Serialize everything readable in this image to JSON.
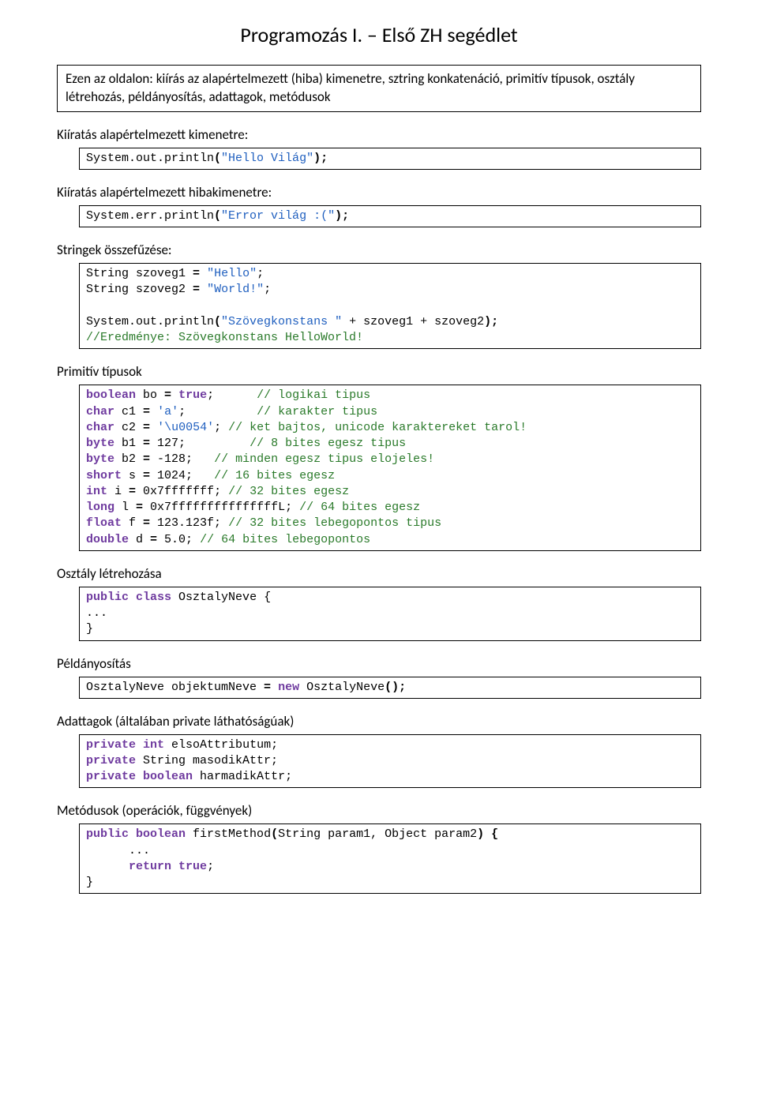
{
  "title": "Programozás I. – Első ZH segédlet",
  "intro": "Ezen az oldalon: kiírás az alapértelmezett (hiba) kimenetre, sztring konkatenáció, primitív típusok, osztály létrehozás, példányosítás, adattagok, metódusok",
  "sections": {
    "out_label": "Kiíratás alapértelmezett kimenetre:",
    "out_code": {
      "l1a": "System.out.println",
      "l1b": "(",
      "l1c": "\"Hello Világ\"",
      "l1d": ");"
    },
    "err_label": "Kiíratás alapértelmezett hibakimenetre:",
    "err_code": {
      "l1a": "System.err.println",
      "l1b": "(",
      "l1c": "\"Error világ :(\"",
      "l1d": ");"
    },
    "concat_label": "Stringek összefűzése:",
    "concat": {
      "l1a": "String szoveg1 ",
      "l1b": "=",
      "l1c": " ",
      "l1d": "\"Hello\"",
      "l1e": ";",
      "l2a": "String szoveg2 ",
      "l2b": "=",
      "l2c": " ",
      "l2d": "\"World!\"",
      "l2e": ";",
      "l3a": "System.out.println",
      "l3b": "(",
      "l3c": "\"Szövegkonstans \"",
      "l3d": " + szoveg1 + szoveg2",
      "l3e": ");",
      "l4": "//Eredménye: Szövegkonstans HelloWorld!"
    },
    "prim_label": "Primitív típusok",
    "prim": {
      "l1a": "boolean",
      "l1b": " bo ",
      "l1c": "=",
      "l1d": " ",
      "l1e": "true",
      "l1f": ";      ",
      "l1g": "// logikai tipus",
      "l2a": "char",
      "l2b": " c1 ",
      "l2c": "=",
      "l2d": " ",
      "l2e": "'a'",
      "l2f": ";          ",
      "l2g": "// karakter tipus",
      "l3a": "char",
      "l3b": " c2 ",
      "l3c": "=",
      "l3d": " ",
      "l3e": "'\\u0054'",
      "l3f": "; ",
      "l3g": "// ket bajtos, unicode karaktereket tarol!",
      "l4a": "byte",
      "l4b": " b1 ",
      "l4c": "=",
      "l4d": " 127;         ",
      "l4g": "// 8 bites egesz tipus",
      "l5a": "byte",
      "l5b": " b2 ",
      "l5c": "=",
      "l5d": " -128;   ",
      "l5g": "// minden egesz tipus elojeles!",
      "l6a": "short",
      "l6b": " s ",
      "l6c": "=",
      "l6d": " 1024;   ",
      "l6g": "// 16 bites egesz",
      "l7a": "int",
      "l7b": " i ",
      "l7c": "=",
      "l7d": " 0x7fffffff; ",
      "l7g": "// 32 bites egesz",
      "l8a": "long",
      "l8b": " l ",
      "l8c": "=",
      "l8d": " 0x7fffffffffffffffL; ",
      "l8g": "// 64 bites egesz",
      "l9a": "float",
      "l9b": " f ",
      "l9c": "=",
      "l9d": " 123.123f; ",
      "l9g": "// 32 bites lebegopontos tipus",
      "l10a": "double",
      "l10b": " d ",
      "l10c": "=",
      "l10d": " 5.0; ",
      "l10g": "// 64 bites lebegopontos"
    },
    "class_label": "Osztály létrehozása",
    "class": {
      "l1a": "public",
      "l1b": " ",
      "l1c": "class",
      "l1d": " OsztalyNeve {",
      "l2": "...",
      "l3": "}"
    },
    "inst_label": "Példányosítás",
    "inst": {
      "l1a": "OsztalyNeve objektumNeve ",
      "l1b": "=",
      "l1c": " ",
      "l1d": "new",
      "l1e": " OsztalyNeve",
      "l1f": "();"
    },
    "attr_label": "Adattagok (általában private láthatóságúak)",
    "attr": {
      "l1a": "private",
      "l1b": " ",
      "l1c": "int",
      "l1d": " elsoAttributum;",
      "l2a": "private",
      "l2b": " String masodikAttr;",
      "l3a": "private",
      "l3b": " ",
      "l3c": "boolean",
      "l3d": " harmadikAttr;"
    },
    "meth_label": "Metódusok (operációk, függvények)",
    "meth": {
      "l1a": "public",
      "l1b": " ",
      "l1c": "boolean",
      "l1d": " firstMethod",
      "l1e": "(",
      "l1f": "String param1, Object param2",
      "l1g": ") {",
      "l2a": "      ...",
      "l3a": "      ",
      "l3b": "return",
      "l3c": " ",
      "l3d": "true",
      "l3e": ";",
      "l4": "}"
    }
  }
}
